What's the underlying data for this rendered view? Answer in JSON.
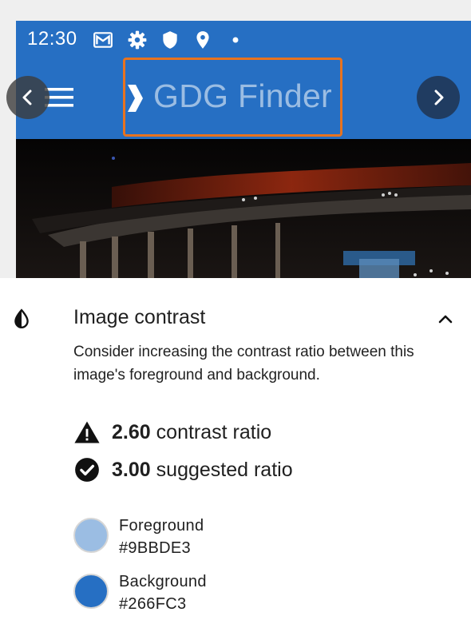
{
  "preview": {
    "status_bar": {
      "time": "12:30",
      "icons": [
        "gmail-icon",
        "settings-icon",
        "shield-icon",
        "location-icon",
        "notification-dot-icon"
      ]
    },
    "app_bar": {
      "title": "GDG Finder",
      "title_color": "#9BBDE3",
      "background_color": "#266FC3"
    },
    "highlight_color": "#e8731f",
    "navigation": {
      "previous_icon": "chevron-left-icon",
      "next_icon": "chevron-right-icon"
    }
  },
  "issue": {
    "icon": "contrast-icon",
    "title": "Image contrast",
    "description": "Consider increasing the contrast ratio between this image's foreground and background.",
    "collapse_icon": "chevron-up-icon",
    "metrics": [
      {
        "icon": "warning-icon",
        "value": "2.60",
        "label": "contrast ratio"
      },
      {
        "icon": "check-circle-icon",
        "value": "3.00",
        "label": "suggested ratio"
      }
    ],
    "colors": [
      {
        "label": "Foreground",
        "hex": "#9BBDE3"
      },
      {
        "label": "Background",
        "hex": "#266FC3"
      }
    ]
  }
}
